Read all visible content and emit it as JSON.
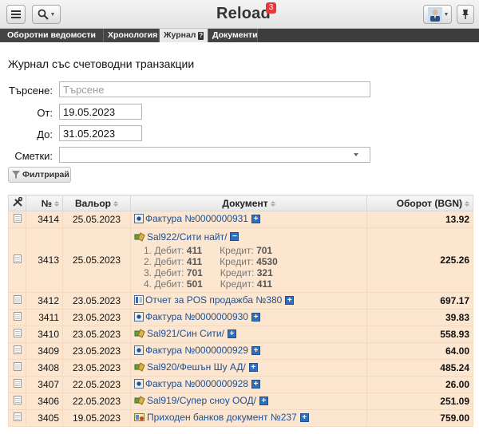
{
  "app": {
    "title": "Reload",
    "badge": "3"
  },
  "tabs": [
    {
      "label": "Оборотни ведомости"
    },
    {
      "label": "Хронология"
    },
    {
      "label": "Журнал"
    },
    {
      "label": "Документи"
    }
  ],
  "page_title": "Журнал със счетоводни транзакции",
  "filters": {
    "search_label": "Търсене:",
    "search_placeholder": "Търсене",
    "from_label": "От:",
    "from_value": "19.05.2023",
    "to_label": "До:",
    "to_value": "31.05.2023",
    "accounts_label": "Сметки:",
    "filter_button": "Филтрирай"
  },
  "table": {
    "headers": {
      "no": "№",
      "date": "Вальор",
      "doc": "Документ",
      "amount": "Оборот (BGN)"
    },
    "rows": [
      {
        "no": "3414",
        "date": "25.05.2023",
        "doc": "Фактура №0000000931",
        "amount": "13.92"
      },
      {
        "no": "3413",
        "date": "25.05.2023",
        "doc": "Sal922/Сити найт/",
        "amount": "225.26",
        "lines": [
          {
            "n": "1. Дебит:",
            "debit": "411",
            "c": "Кредит:",
            "credit": "701"
          },
          {
            "n": "2. Дебит:",
            "debit": "411",
            "c": "Кредит:",
            "credit": "4530"
          },
          {
            "n": "3. Дебит:",
            "debit": "701",
            "c": "Кредит:",
            "credit": "321"
          },
          {
            "n": "4. Дебит:",
            "debit": "501",
            "c": "Кредит:",
            "credit": "411"
          }
        ]
      },
      {
        "no": "3412",
        "date": "23.05.2023",
        "doc": "Отчет за POS продажба №380",
        "amount": "697.17"
      },
      {
        "no": "3411",
        "date": "23.05.2023",
        "doc": "Фактура №0000000930",
        "amount": "39.83"
      },
      {
        "no": "3410",
        "date": "23.05.2023",
        "doc": "Sal921/Син Сити/",
        "amount": "558.93"
      },
      {
        "no": "3409",
        "date": "23.05.2023",
        "doc": "Фактура №0000000929",
        "amount": "64.00"
      },
      {
        "no": "3408",
        "date": "23.05.2023",
        "doc": "Sal920/Фешън Шу АД/",
        "amount": "485.24"
      },
      {
        "no": "3407",
        "date": "22.05.2023",
        "doc": "Фактура №0000000928",
        "amount": "26.00"
      },
      {
        "no": "3406",
        "date": "22.05.2023",
        "doc": "Sal919/Супер сноу ООД/",
        "amount": "251.09"
      },
      {
        "no": "3405",
        "date": "19.05.2023",
        "doc": "Приходен банков документ №237",
        "amount": "759.00"
      }
    ]
  }
}
